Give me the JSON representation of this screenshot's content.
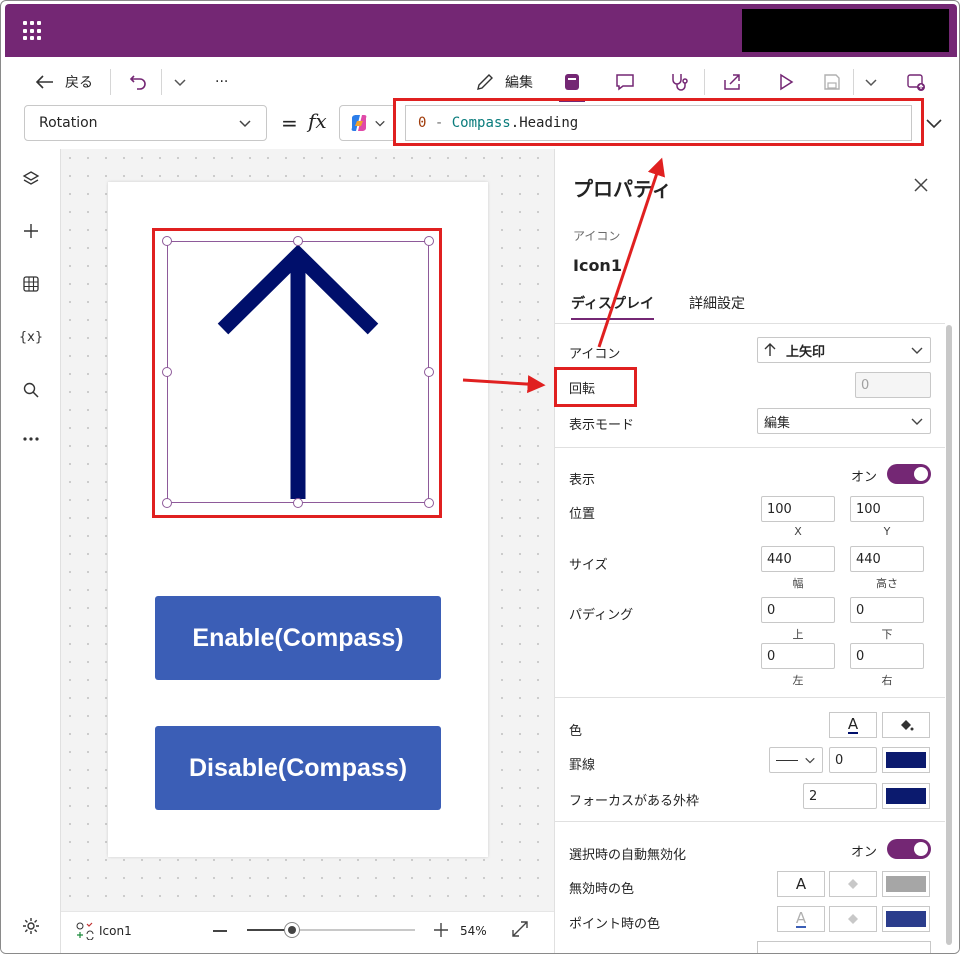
{
  "app": {
    "accent": "#742774"
  },
  "command_bar": {
    "back_label": "戻る",
    "edit_label": "編集",
    "more_label": "···"
  },
  "formula_bar": {
    "property": "Rotation",
    "equals": "=",
    "fx": "fx",
    "formula_number": "0",
    "formula_operator": " - ",
    "formula_control": "Compass",
    "formula_dot": ".",
    "formula_property": "Heading"
  },
  "canvas": {
    "arrow_color": "#000f6b",
    "buttons": [
      {
        "label": "Enable(Compass)"
      },
      {
        "label": "Disable(Compass)"
      }
    ],
    "button_color": "#3b5eb6"
  },
  "statusbar": {
    "selected_control": "Icon1",
    "zoom": "54%"
  },
  "properties_panel": {
    "title": "プロパティ",
    "control_type": "アイコン",
    "control_name": "Icon1",
    "tabs": [
      "ディスプレイ",
      "詳細設定"
    ],
    "icon_label": "アイコン",
    "icon_value": "上矢印",
    "rotation_label": "回転",
    "rotation_value": "0",
    "display_mode_label": "表示モード",
    "display_mode_value": "編集",
    "visible_label": "表示",
    "visible_value": "オン",
    "position_label": "位置",
    "position_x": "100",
    "position_y": "100",
    "position_x_cap": "X",
    "position_y_cap": "Y",
    "size_label": "サイズ",
    "size_w": "440",
    "size_h": "440",
    "size_w_cap": "幅",
    "size_h_cap": "高さ",
    "padding_label": "パディング",
    "padding_top": "0",
    "padding_bottom": "0",
    "padding_left": "0",
    "padding_right": "0",
    "padding_top_cap": "上",
    "padding_bottom_cap": "下",
    "padding_left_cap": "左",
    "padding_right_cap": "右",
    "color_label": "色",
    "color_text_glyph": "A",
    "border_label": "罫線",
    "border_width": "0",
    "focus_border_label": "フォーカスがある外枠",
    "focus_border_width": "2",
    "auto_disable_label": "選択時の自動無効化",
    "auto_disable_value": "オン",
    "disabled_color_label": "無効時の色",
    "hover_color_label": "ポイント時の色",
    "border_color": "#0b1a6e",
    "disabled_fill": "#a6a6a6",
    "hover_fill": "#2b3d8c"
  }
}
